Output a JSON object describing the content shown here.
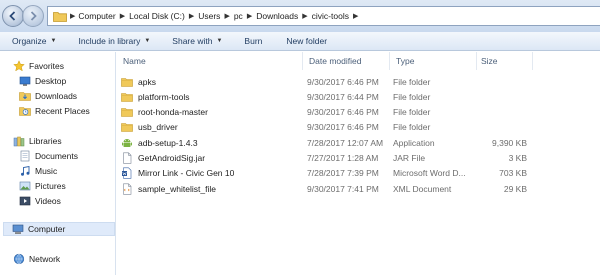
{
  "address": {
    "crumbs": [
      "Computer",
      "Local Disk (C:)",
      "Users",
      "pc",
      "Downloads",
      "civic-tools"
    ]
  },
  "toolbar": {
    "organize": "Organize",
    "include_in_library": "Include in library",
    "share_with": "Share with",
    "burn": "Burn",
    "new_folder": "New folder"
  },
  "navpane": {
    "favorites": "Favorites",
    "desktop": "Desktop",
    "downloads": "Downloads",
    "recent_places": "Recent Places",
    "libraries": "Libraries",
    "documents": "Documents",
    "music": "Music",
    "pictures": "Pictures",
    "videos": "Videos",
    "computer": "Computer",
    "network": "Network"
  },
  "columns": {
    "name": "Name",
    "date_modified": "Date modified",
    "type": "Type",
    "size": "Size"
  },
  "files": [
    {
      "name": "apks",
      "date": "9/30/2017 6:46 PM",
      "type": "File folder",
      "size": "",
      "icon": "folder-icon"
    },
    {
      "name": "platform-tools",
      "date": "9/30/2017 6:44 PM",
      "type": "File folder",
      "size": "",
      "icon": "folder-icon"
    },
    {
      "name": "root-honda-master",
      "date": "9/30/2017 6:46 PM",
      "type": "File folder",
      "size": "",
      "icon": "folder-icon"
    },
    {
      "name": "usb_driver",
      "date": "9/30/2017 6:46 PM",
      "type": "File folder",
      "size": "",
      "icon": "folder-icon"
    },
    {
      "name": "adb-setup-1.4.3",
      "date": "7/28/2017 12:07 AM",
      "type": "Application",
      "size": "9,390 KB",
      "icon": "android-icon"
    },
    {
      "name": "GetAndroidSig.jar",
      "date": "7/27/2017 1:28 AM",
      "type": "JAR File",
      "size": "3 KB",
      "icon": "jar-file-icon"
    },
    {
      "name": "Mirror Link - Civic Gen 10",
      "date": "7/28/2017 7:39 PM",
      "type": "Microsoft Word D...",
      "size": "703 KB",
      "icon": "word-document-icon"
    },
    {
      "name": "sample_whitelist_file",
      "date": "9/30/2017 7:41 PM",
      "type": "XML Document",
      "size": "29 KB",
      "icon": "xml-document-icon"
    }
  ]
}
